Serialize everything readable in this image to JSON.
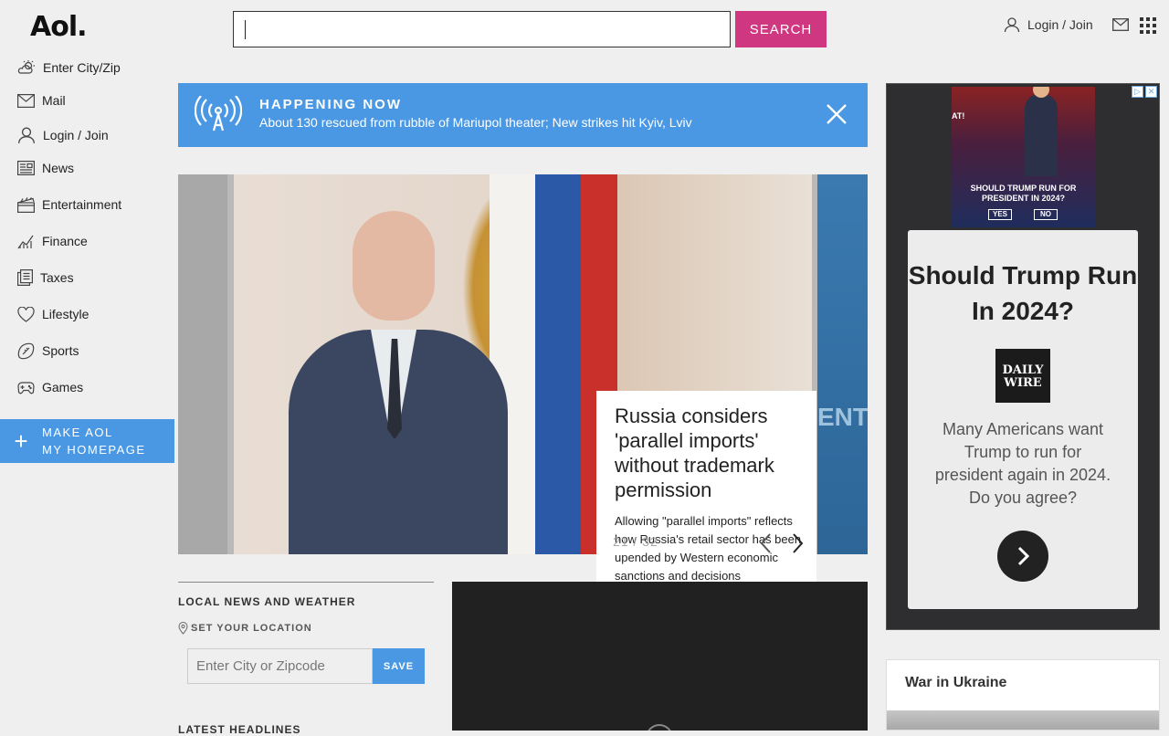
{
  "header": {
    "logo": "Aol.",
    "search_value": "",
    "search_button": "SEARCH",
    "login": "Login / Join"
  },
  "sidebar": {
    "items": [
      {
        "label": "Enter City/Zip",
        "icon": "weather-icon"
      },
      {
        "label": "Mail",
        "icon": "mail-icon"
      },
      {
        "label": "Login / Join",
        "icon": "user-icon"
      },
      {
        "label": "News",
        "icon": "news-icon"
      },
      {
        "label": "Entertainment",
        "icon": "clapperboard-icon"
      },
      {
        "label": "Finance",
        "icon": "chart-icon"
      },
      {
        "label": "Taxes",
        "icon": "documents-icon"
      },
      {
        "label": "Lifestyle",
        "icon": "heart-icon"
      },
      {
        "label": "Sports",
        "icon": "football-icon"
      },
      {
        "label": "Games",
        "icon": "gamepad-icon"
      }
    ],
    "homepage_line1": "MAKE AOL",
    "homepage_line2": "MY HOMEPAGE"
  },
  "happening": {
    "tag": "HAPPENING NOW",
    "headline": "About 130 rescued from rubble of Mariupol theater; New strikes hit Kyiv, Lviv"
  },
  "hero": {
    "title": "Russia considers 'parallel imports' without trademark permission",
    "summary": "Allowing \"parallel imports\" reflects how Russia's retail sector has been upended by Western economic sanctions and decisions",
    "counter": "21 / 32",
    "right_strip_text": "ENT"
  },
  "local": {
    "title": "LOCAL NEWS AND WEATHER",
    "set_location": "SET YOUR LOCATION",
    "zip_placeholder": "Enter City or Zipcode",
    "save": "SAVE",
    "latest": "LATEST HEADLINES"
  },
  "ad": {
    "image_question": "SHOULD TRUMP RUN FOR PRESIDENT IN 2024?",
    "image_yes": "YES",
    "image_no": "NO",
    "image_burst": "AT!",
    "question": "Should Trump Run In 2024?",
    "logo_line1": "DAILY",
    "logo_line2": "WIRE",
    "body": "Many Americans want Trump to run for president again in 2024. Do you agree?"
  },
  "ukraine": {
    "title": "War in Ukraine"
  },
  "colors": {
    "accent_pink": "#cf3880",
    "accent_blue": "#4a98e4",
    "background": "#efefef"
  }
}
